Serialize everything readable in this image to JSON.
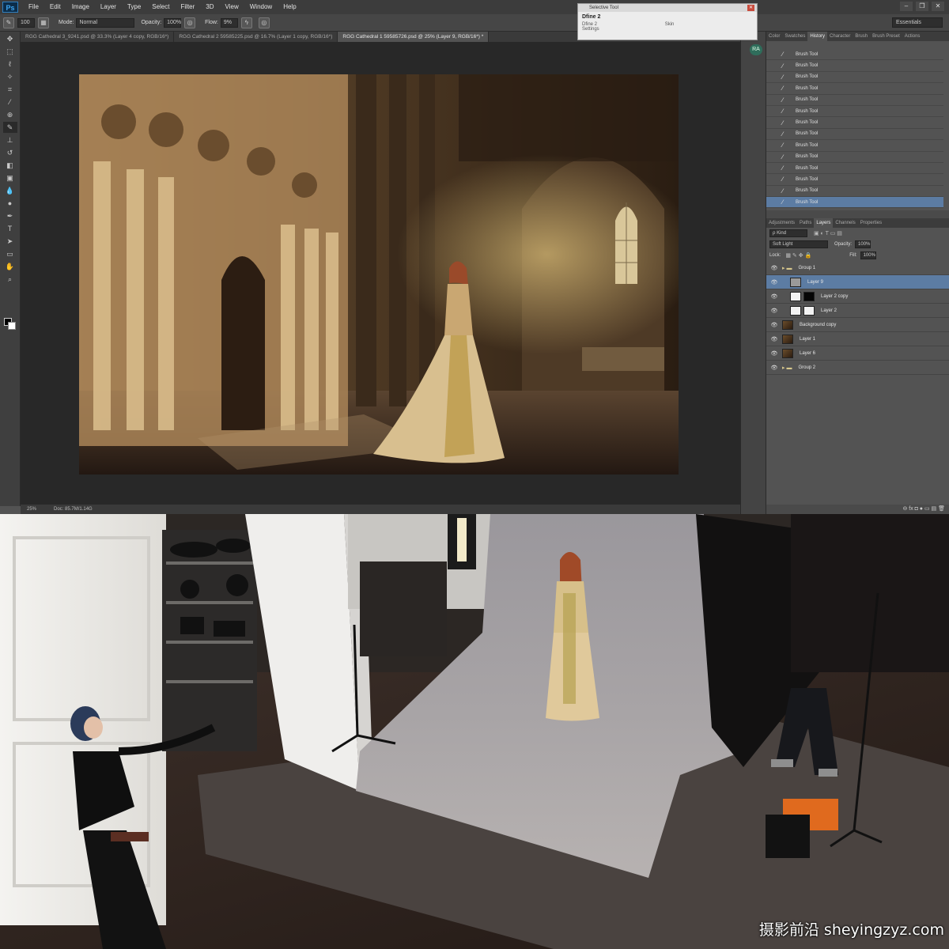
{
  "app": {
    "logo": "Ps"
  },
  "menu": [
    "File",
    "Edit",
    "Image",
    "Layer",
    "Type",
    "Select",
    "Filter",
    "3D",
    "View",
    "Window",
    "Help"
  ],
  "window_controls": [
    "–",
    "❐",
    "✕"
  ],
  "options": {
    "brush_size": "100",
    "mode_label": "Mode:",
    "mode_value": "Normal",
    "opacity_label": "Opacity:",
    "opacity_value": "100%",
    "flow_label": "Flow:",
    "flow_value": "9%",
    "workspace": "Essentials"
  },
  "tabs": [
    {
      "label": "RGG Cathedral 3_9241.psd @ 33.3% (Layer 4 copy, RGB/16*)",
      "active": false
    },
    {
      "label": "RGG Cathedral 2 59585225.psd @ 16.7% (Layer 1 copy, RGB/16*)",
      "active": false
    },
    {
      "label": "RGG Cathedral 1 59585726.psd @ 25% (Layer 9, RGB/16*) *",
      "active": true
    }
  ],
  "selective_tool": {
    "title": "Selective Tool",
    "name": "Dfine 2",
    "row1": "Dfine 2",
    "row2": "Settings",
    "row_right": "Skin"
  },
  "ra_badge": "RA",
  "status": {
    "zoom": "25%",
    "doc": "Doc: 85.7M/1.14G"
  },
  "panels": {
    "top_tabs": [
      {
        "label": "Color",
        "active": false
      },
      {
        "label": "Swatches",
        "active": false
      },
      {
        "label": "History",
        "active": true
      },
      {
        "label": "Character",
        "active": false
      },
      {
        "label": "Brush",
        "active": false
      },
      {
        "label": "Brush Preset",
        "active": false
      },
      {
        "label": "Actions",
        "active": false
      }
    ],
    "history": [
      "Brush Tool",
      "Brush Tool",
      "Brush Tool",
      "Brush Tool",
      "Brush Tool",
      "Brush Tool",
      "Brush Tool",
      "Brush Tool",
      "Brush Tool",
      "Brush Tool",
      "Brush Tool",
      "Brush Tool",
      "Brush Tool",
      "Brush Tool"
    ],
    "layer_tabs": [
      {
        "label": "Adjustments",
        "active": false
      },
      {
        "label": "Paths",
        "active": false
      },
      {
        "label": "Layers",
        "active": true
      },
      {
        "label": "Channels",
        "active": false
      },
      {
        "label": "Properties",
        "active": false
      }
    ],
    "kind_label": "ρ Kind",
    "blend_mode": "Soft Light",
    "opacity_label": "Opacity:",
    "opacity_value": "100%",
    "lock_label": "Lock:",
    "fill_label": "Fill:",
    "fill_value": "100%",
    "layers": [
      {
        "name": "Group 1",
        "type": "group",
        "selected": false
      },
      {
        "name": "Layer 9",
        "type": "grey",
        "selected": true
      },
      {
        "name": "Layer 2 copy",
        "type": "masked-black",
        "selected": false
      },
      {
        "name": "Layer 2",
        "type": "masked",
        "selected": false
      },
      {
        "name": "Background copy",
        "type": "photo",
        "selected": false
      },
      {
        "name": "Layer 1",
        "type": "photo",
        "selected": false
      },
      {
        "name": "Layer 6",
        "type": "photo",
        "selected": false
      },
      {
        "name": "Group 2",
        "type": "group",
        "selected": false
      }
    ],
    "footer_icons": "⊖ fx ◘ ● ▭ ▤ 🗑"
  },
  "watermark": "摄影前沿 sheyingzyz.com"
}
